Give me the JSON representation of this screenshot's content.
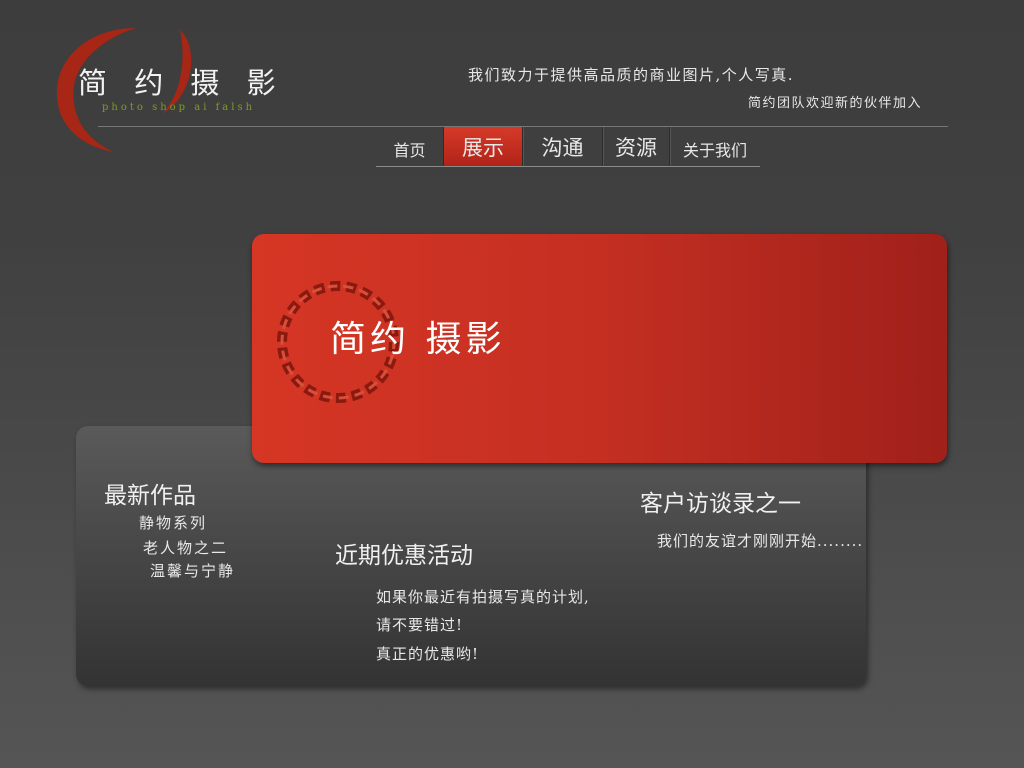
{
  "logo": {
    "title": "简 约 摄 影",
    "subtitle": "photo shop ai falsh"
  },
  "header": {
    "slogan": "我们致力于提供高品质的商业图片,个人写真.",
    "recruit": "简约团队欢迎新的伙伴加入"
  },
  "nav": {
    "items": [
      {
        "label": "首页"
      },
      {
        "label": "展示"
      },
      {
        "label": "沟通"
      },
      {
        "label": "资源"
      },
      {
        "label": "关于我们"
      }
    ],
    "active": "展示"
  },
  "banner": {
    "title": "简约 摄影"
  },
  "works": {
    "title": "最新作品",
    "items": [
      "静物系列",
      "老人物之二",
      "温馨与宁静"
    ]
  },
  "promo": {
    "title": "近期优惠活动",
    "lines": [
      "如果你最近有拍摄写真的计划,",
      "请不要错过!",
      "真正的优惠哟!"
    ]
  },
  "interview": {
    "title": "客户访谈录之一",
    "text": "我们的友谊才刚刚开始........"
  },
  "colors": {
    "accent_red": "#c83024",
    "logo_green": "#7d9a26",
    "background": "#444444"
  }
}
